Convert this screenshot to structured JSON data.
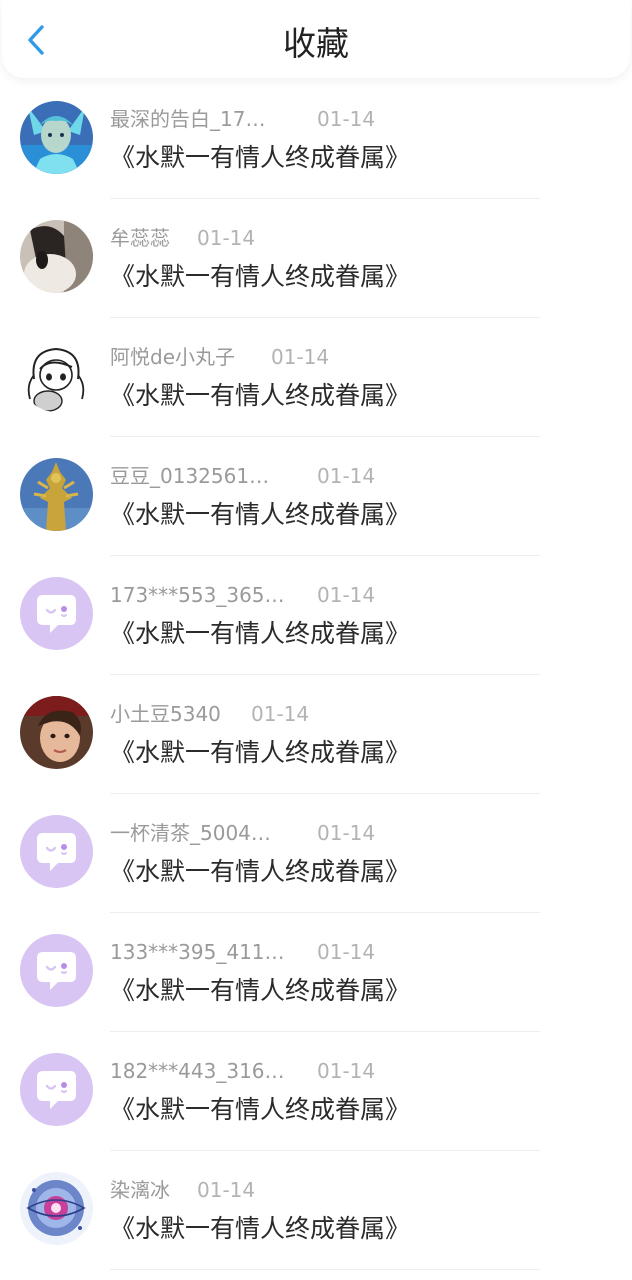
{
  "header": {
    "title": "收藏",
    "back_icon": "chevron-left-icon",
    "accent_color": "#2f9ae8"
  },
  "items": [
    {
      "user": "最深的告白_17…",
      "date": "01-14",
      "title": "《水默一有情人终成眷属》",
      "avatar": "game-character-avatar"
    },
    {
      "user": "牟蕊蕊",
      "date": "01-14",
      "title": "《水默一有情人终成眷属》",
      "avatar": "photo-avatar"
    },
    {
      "user": "阿悦de小丸子",
      "date": "01-14",
      "title": "《水默一有情人终成眷属》",
      "avatar": "anime-girl-avatar"
    },
    {
      "user": "豆豆_0132561…",
      "date": "01-14",
      "title": "《水默一有情人终成眷属》",
      "avatar": "golden-statue-avatar"
    },
    {
      "user": "173***553_365…",
      "date": "01-14",
      "title": "《水默一有情人终成眷属》",
      "avatar": "default-chat-avatar"
    },
    {
      "user": "小土豆5340",
      "date": "01-14",
      "title": "《水默一有情人终成眷属》",
      "avatar": "portrait-avatar"
    },
    {
      "user": "一杯清茶_5004…",
      "date": "01-14",
      "title": "《水默一有情人终成眷属》",
      "avatar": "default-chat-avatar"
    },
    {
      "user": "133***395_411…",
      "date": "01-14",
      "title": "《水默一有情人终成眷属》",
      "avatar": "default-chat-avatar"
    },
    {
      "user": "182***443_316…",
      "date": "01-14",
      "title": "《水默一有情人终成眷属》",
      "avatar": "default-chat-avatar"
    },
    {
      "user": "染漓冰",
      "date": "01-14",
      "title": "《水默一有情人终成眷属》",
      "avatar": "cosmic-avatar"
    }
  ],
  "colors": {
    "user_text": "#9a9a9a",
    "date_text": "#b3b3b3",
    "title_text": "#2b2b2b",
    "default_avatar_bg": "#d8c5f3"
  }
}
